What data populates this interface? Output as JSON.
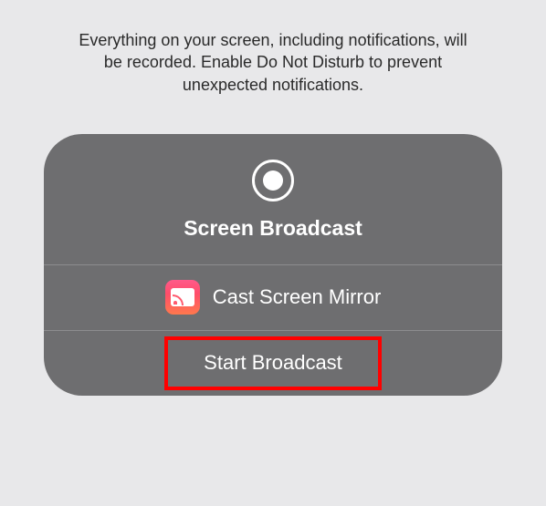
{
  "warning_text": "Everything on your screen, including notifications, will be recorded. Enable Do Not Disturb to prevent unexpected notifications.",
  "panel": {
    "title": "Screen Broadcast",
    "app_option_label": "Cast Screen Mirror",
    "start_label": "Start Broadcast"
  }
}
